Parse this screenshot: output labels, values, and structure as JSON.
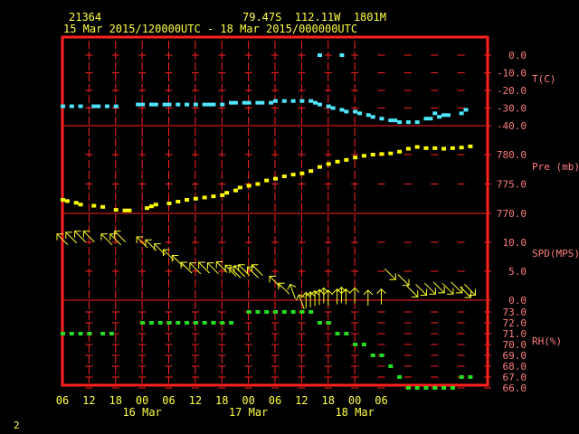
{
  "header": {
    "station": "21364",
    "location": "79.47S  112.11W  1801M",
    "period": "15 Mar 2015/120000UTC - 18 Mar 2015/000000UTC"
  },
  "footer": {
    "page": "2"
  },
  "colors": {
    "frame": "#ff2020",
    "grid": "#ff2020",
    "axis_text": "#ff7d7d",
    "time_text": "#ffff44",
    "temp": "#4fe8ff",
    "pressure": "#ffff00",
    "wind": "#ffff2a",
    "rh": "#22dd22"
  },
  "chart_data": {
    "type": "scatter",
    "x_unit": "hours since 15 Mar 2015 06 UTC",
    "x_ticks": [
      "06",
      "12",
      "18",
      "00",
      "06",
      "12",
      "18",
      "00",
      "06",
      "12",
      "18",
      "00",
      "06"
    ],
    "date_labels": [
      "16 Mar",
      "17 Mar",
      "18 Mar"
    ],
    "panels": [
      {
        "key": "temp",
        "label": "T(C)",
        "ylim": [
          -40,
          0
        ],
        "ticks": [
          "0.0",
          "-10.0",
          "-20.0",
          "-30.0",
          "-40.0"
        ],
        "tick_values": [
          0,
          -10,
          -20,
          -30,
          -40
        ],
        "points": [
          [
            6,
            -29
          ],
          [
            8,
            -29
          ],
          [
            10,
            -29
          ],
          [
            13,
            -29
          ],
          [
            14,
            -29
          ],
          [
            16,
            -29
          ],
          [
            18,
            -29
          ],
          [
            23,
            -28
          ],
          [
            24,
            -28
          ],
          [
            26,
            -28
          ],
          [
            27,
            -28
          ],
          [
            29,
            -28
          ],
          [
            30,
            -28
          ],
          [
            32,
            -28
          ],
          [
            34,
            -28
          ],
          [
            36,
            -28
          ],
          [
            38,
            -28
          ],
          [
            39,
            -28
          ],
          [
            40,
            -28
          ],
          [
            42,
            -28
          ],
          [
            44,
            -27
          ],
          [
            45,
            -27
          ],
          [
            47,
            -27
          ],
          [
            48,
            -27
          ],
          [
            50,
            -27
          ],
          [
            51,
            -27
          ],
          [
            53,
            -27
          ],
          [
            54,
            -26
          ],
          [
            56,
            -26
          ],
          [
            58,
            -26
          ],
          [
            60,
            -26
          ],
          [
            62,
            -26
          ],
          [
            63,
            -27
          ],
          [
            64,
            -28
          ],
          [
            66,
            -29
          ],
          [
            67,
            -30
          ],
          [
            69,
            -31
          ],
          [
            70,
            -32
          ],
          [
            72,
            -32
          ],
          [
            73,
            -33
          ],
          [
            75,
            -34
          ],
          [
            76,
            -35
          ],
          [
            78,
            -36
          ],
          [
            80,
            -37
          ],
          [
            81,
            -37
          ],
          [
            82,
            -38
          ],
          [
            84,
            -38
          ],
          [
            86,
            -38
          ],
          [
            88,
            -36
          ],
          [
            89,
            -36
          ],
          [
            90,
            -33
          ],
          [
            91,
            -35
          ],
          [
            92,
            -34
          ],
          [
            93,
            -34
          ],
          [
            96,
            -33
          ],
          [
            97,
            -31
          ],
          [
            64,
            0
          ],
          [
            69,
            0
          ]
        ]
      },
      {
        "key": "pressure",
        "label": "Pre (mb)",
        "ylim": [
          770,
          780
        ],
        "ticks": [
          "780.0",
          "775.0",
          "770.0"
        ],
        "tick_values": [
          780,
          775,
          770
        ],
        "points": [
          [
            6,
            772.3
          ],
          [
            7,
            772.1
          ],
          [
            9,
            771.8
          ],
          [
            10,
            771.5
          ],
          [
            13,
            771.3
          ],
          [
            15,
            771.1
          ],
          [
            18,
            770.6
          ],
          [
            20,
            770.5
          ],
          [
            21,
            770.5
          ],
          [
            25,
            770.9
          ],
          [
            26,
            771.2
          ],
          [
            27,
            771.5
          ],
          [
            30,
            771.7
          ],
          [
            32,
            772.0
          ],
          [
            34,
            772.3
          ],
          [
            36,
            772.5
          ],
          [
            38,
            772.7
          ],
          [
            40,
            772.9
          ],
          [
            42,
            773.1
          ],
          [
            43,
            773.5
          ],
          [
            45,
            773.9
          ],
          [
            46,
            774.4
          ],
          [
            48,
            774.7
          ],
          [
            50,
            775.0
          ],
          [
            52,
            775.6
          ],
          [
            54,
            775.9
          ],
          [
            56,
            776.3
          ],
          [
            58,
            776.6
          ],
          [
            60,
            776.8
          ],
          [
            62,
            777.2
          ],
          [
            64,
            777.9
          ],
          [
            66,
            778.4
          ],
          [
            68,
            778.8
          ],
          [
            70,
            779.1
          ],
          [
            72,
            779.5
          ],
          [
            74,
            779.8
          ],
          [
            76,
            780.0
          ],
          [
            78,
            780.1
          ],
          [
            80,
            780.2
          ],
          [
            82,
            780.5
          ],
          [
            84,
            781.0
          ],
          [
            86,
            781.3
          ],
          [
            88,
            781.1
          ],
          [
            90,
            781.1
          ],
          [
            92,
            781.0
          ],
          [
            94,
            781.1
          ],
          [
            96,
            781.2
          ],
          [
            98,
            781.4
          ]
        ]
      },
      {
        "key": "wind",
        "label": "SPD(MPS)",
        "ylim": [
          0,
          10
        ],
        "ticks": [
          "10.0",
          "5.0",
          "0.0"
        ],
        "tick_values": [
          10,
          5,
          0
        ],
        "barbs": [
          [
            6,
            10.5,
            45
          ],
          [
            8,
            10.8,
            45
          ],
          [
            10,
            11,
            45
          ],
          [
            12,
            11,
            45
          ],
          [
            16,
            10.5,
            45
          ],
          [
            18,
            10.5,
            45
          ],
          [
            19,
            11,
            45
          ],
          [
            24,
            10,
            45
          ],
          [
            26,
            9.5,
            45
          ],
          [
            28,
            8.8,
            45
          ],
          [
            30,
            7.8,
            45
          ],
          [
            32,
            6.8,
            45
          ],
          [
            34,
            5.6,
            45
          ],
          [
            36,
            5.5,
            45
          ],
          [
            38,
            5.6,
            45
          ],
          [
            40,
            5.5,
            45
          ],
          [
            42,
            5.7,
            45
          ],
          [
            44,
            5.1,
            45
          ],
          [
            45,
            4.8,
            45
          ],
          [
            46,
            5,
            45
          ],
          [
            47,
            5.2,
            45
          ],
          [
            49,
            4.8,
            45
          ],
          [
            50,
            5.2,
            45
          ],
          [
            54,
            3.2,
            45
          ],
          [
            56,
            2,
            45
          ],
          [
            58,
            1.5,
            70
          ],
          [
            60,
            -0.3,
            70
          ],
          [
            61,
            0,
            90
          ],
          [
            62,
            0.1,
            90
          ],
          [
            63,
            0.3,
            90
          ],
          [
            64,
            0.5,
            90
          ],
          [
            65,
            0.8,
            90
          ],
          [
            66,
            0.4,
            90
          ],
          [
            68,
            0.6,
            90
          ],
          [
            69,
            0.9,
            90
          ],
          [
            70,
            0.6,
            90
          ],
          [
            72,
            0.8,
            90
          ],
          [
            75,
            0.4,
            90
          ],
          [
            78,
            0.6,
            90
          ],
          [
            80,
            4.5,
            225
          ],
          [
            83,
            3.5,
            225
          ],
          [
            85,
            1.5,
            225
          ],
          [
            87,
            1.8,
            225
          ],
          [
            89,
            2.0,
            225
          ],
          [
            91,
            2.2,
            225
          ],
          [
            93,
            2.0,
            225
          ],
          [
            95,
            2.2,
            225
          ],
          [
            97,
            1.4,
            225
          ],
          [
            98,
            1.8,
            225
          ]
        ]
      },
      {
        "key": "rh",
        "label": "RH(%)",
        "ylim": [
          66,
          73
        ],
        "ticks": [
          "73.0",
          "72.0",
          "71.0",
          "70.0",
          "69.0",
          "68.0",
          "67.0",
          "66.0"
        ],
        "tick_values": [
          73,
          72,
          71,
          70,
          69,
          68,
          67,
          66
        ],
        "points": [
          [
            6,
            71
          ],
          [
            8,
            71
          ],
          [
            10,
            71
          ],
          [
            12,
            71
          ],
          [
            15,
            71
          ],
          [
            17,
            71
          ],
          [
            24,
            72
          ],
          [
            26,
            72
          ],
          [
            28,
            72
          ],
          [
            30,
            72
          ],
          [
            32,
            72
          ],
          [
            34,
            72
          ],
          [
            36,
            72
          ],
          [
            38,
            72
          ],
          [
            40,
            72
          ],
          [
            42,
            72
          ],
          [
            44,
            72
          ],
          [
            48,
            73
          ],
          [
            50,
            73
          ],
          [
            52,
            73
          ],
          [
            54,
            73
          ],
          [
            56,
            73
          ],
          [
            58,
            73
          ],
          [
            60,
            73
          ],
          [
            62,
            73
          ],
          [
            64,
            72
          ],
          [
            66,
            72
          ],
          [
            68,
            71
          ],
          [
            70,
            71
          ],
          [
            72,
            70
          ],
          [
            74,
            70
          ],
          [
            76,
            69
          ],
          [
            78,
            69
          ],
          [
            80,
            68
          ],
          [
            82,
            67
          ],
          [
            84,
            66
          ],
          [
            86,
            66
          ],
          [
            88,
            66
          ],
          [
            90,
            66
          ],
          [
            92,
            66
          ],
          [
            94,
            66
          ],
          [
            96,
            67
          ],
          [
            98,
            67
          ]
        ]
      }
    ]
  }
}
